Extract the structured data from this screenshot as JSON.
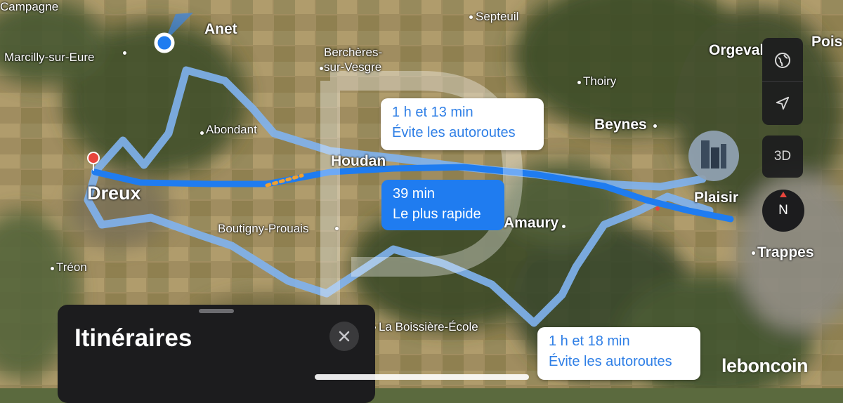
{
  "places": [
    {
      "id": "campagne",
      "label": "Campagne",
      "size": "small"
    },
    {
      "id": "marcilly",
      "label": "Marcilly-sur-Eure",
      "size": "small"
    },
    {
      "id": "anet",
      "label": "Anet",
      "size": "med"
    },
    {
      "id": "bercheres",
      "label": "Berchères-\nsur-Vesgre",
      "size": "small"
    },
    {
      "id": "septeuil",
      "label": "Septeuil",
      "size": "small"
    },
    {
      "id": "poiss",
      "label": "Poiss",
      "size": "med"
    },
    {
      "id": "orgeval",
      "label": "Orgeval",
      "size": "med"
    },
    {
      "id": "thoiry",
      "label": "Thoiry",
      "size": "small"
    },
    {
      "id": "abondant",
      "label": "Abondant",
      "size": "small"
    },
    {
      "id": "beynes",
      "label": "Beynes",
      "size": "med"
    },
    {
      "id": "houdan",
      "label": "Houdan",
      "size": "med"
    },
    {
      "id": "dreux",
      "label": "Dreux",
      "size": "big"
    },
    {
      "id": "plaisir",
      "label": "Plaisir",
      "size": "med"
    },
    {
      "id": "boutigny",
      "label": "Boutigny-Prouais",
      "size": "small"
    },
    {
      "id": "amaury",
      "label": "Amaury",
      "size": "med"
    },
    {
      "id": "trappes",
      "label": "Trappes",
      "size": "med"
    },
    {
      "id": "treon",
      "label": "Tréon",
      "size": "small"
    },
    {
      "id": "boissiere",
      "label": "La Boissière-École",
      "size": "small"
    }
  ],
  "routes": [
    {
      "id": "route-1",
      "duration": "1 h et 13 min",
      "note": "Évite les autoroutes",
      "selected": false
    },
    {
      "id": "route-2",
      "duration": "39 min",
      "note": "Le plus rapide",
      "selected": true
    },
    {
      "id": "route-3",
      "duration": "1 h et 18 min",
      "note": "Évite les autoroutes",
      "selected": false
    }
  ],
  "controls": {
    "globe_icon": "globe-icon",
    "location_icon": "location-arrow-icon",
    "view_3d_label": "3D",
    "compass_label": "N"
  },
  "sheet": {
    "title": "Itinéraires",
    "close_icon": "close-icon"
  },
  "watermark": "leboncoin",
  "colors": {
    "route_selected": "#1f7cf0",
    "route_alt": "#7fb3f0",
    "callout_text_alt": "#2f7fe6",
    "sheet_bg": "#1c1c1e"
  }
}
